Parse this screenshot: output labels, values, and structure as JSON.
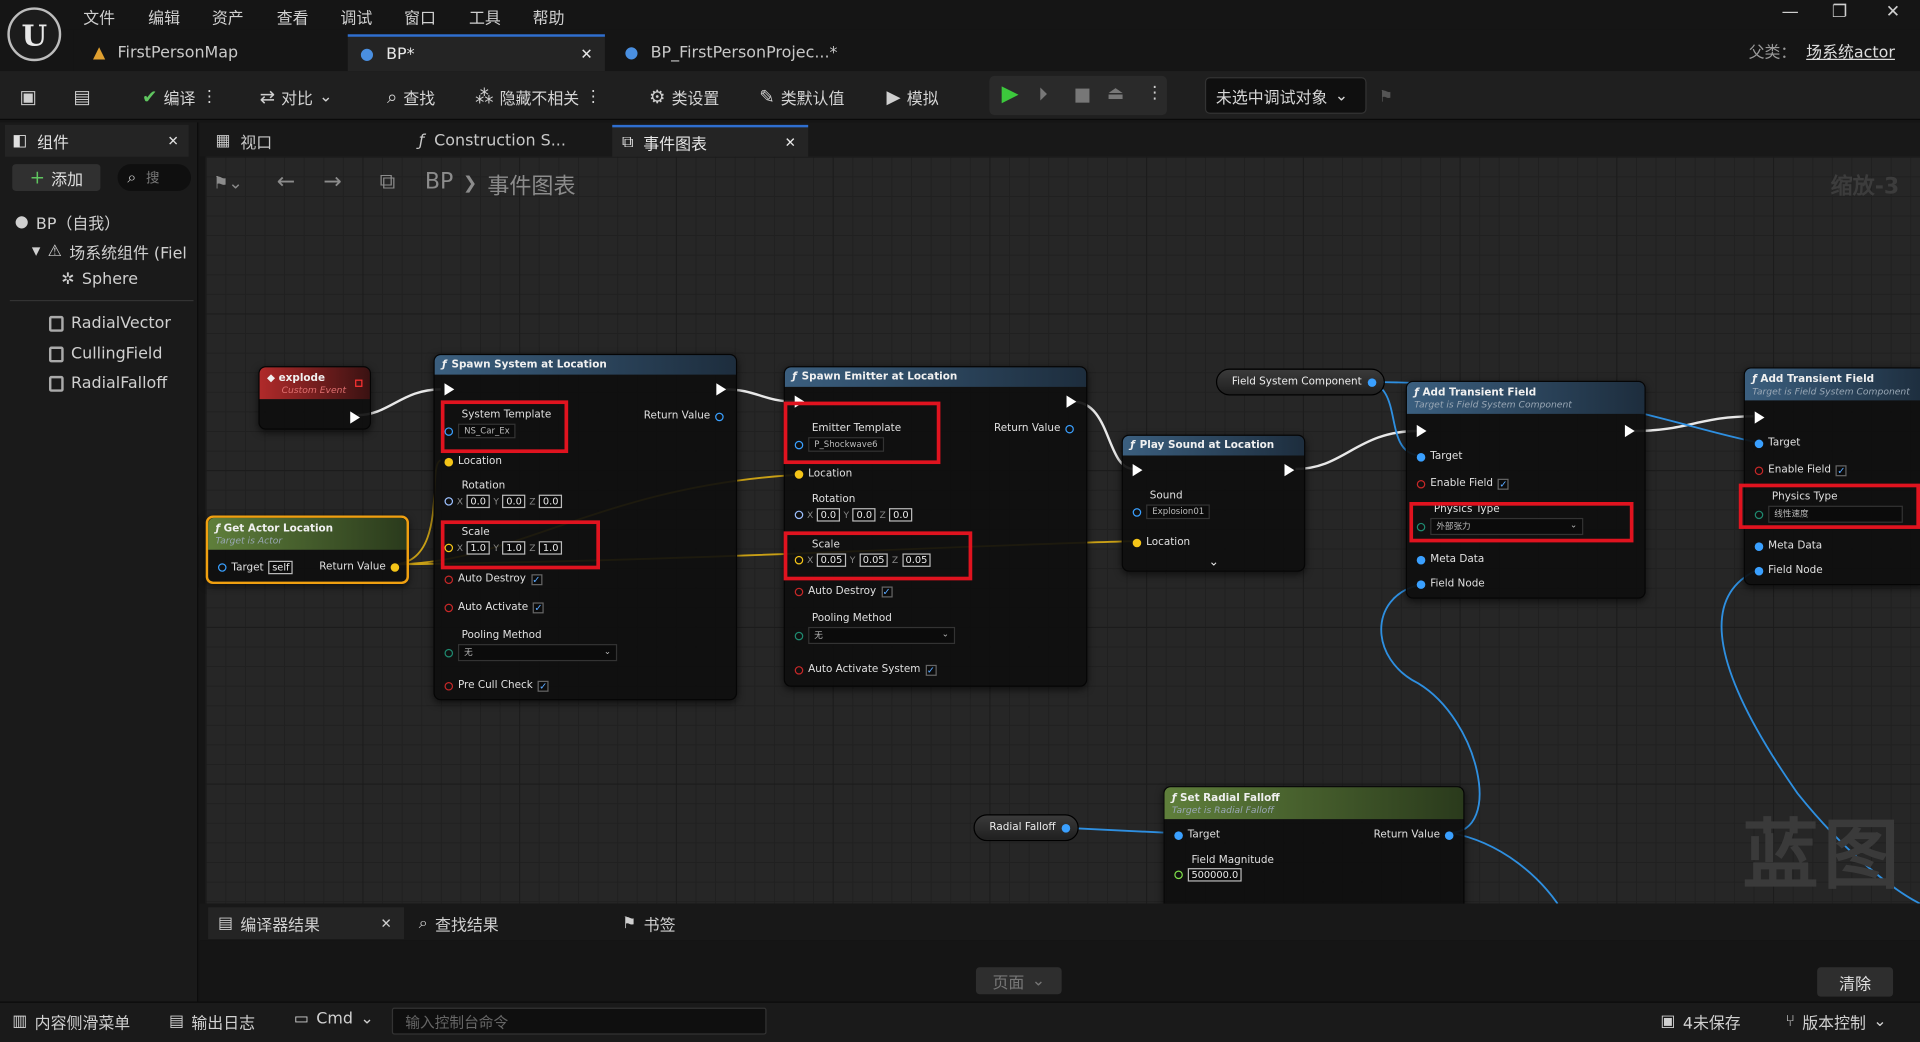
{
  "menu": [
    "文件",
    "编辑",
    "资产",
    "查看",
    "调试",
    "窗口",
    "工具",
    "帮助"
  ],
  "logo": "U",
  "window_controls": [
    "—",
    "❐",
    "✕"
  ],
  "doc_tabs": [
    {
      "label": "FirstPersonMap"
    },
    {
      "label": "BP*"
    },
    {
      "label": "BP_FirstPersonProjec...*"
    }
  ],
  "parent_class": {
    "prefix": "父类：",
    "name": "场系统actor"
  },
  "toolbar": {
    "compile": "编译",
    "diff": "对比",
    "find": "查找",
    "hide_unrelated": "隐藏不相关",
    "class_settings": "类设置",
    "class_defaults": "类默认值",
    "simulate": "模拟",
    "debug_object": "未选中调试对象"
  },
  "components_panel": {
    "tab": "组件",
    "add_button": "添加",
    "search_placeholder": "搜",
    "tree": [
      "BP（自我）",
      "场系统组件 (Fiel",
      "Sphere"
    ],
    "variables": [
      "RadialVector",
      "CullingField",
      "RadialFalloff"
    ]
  },
  "graph_tabs": [
    {
      "label": "视口"
    },
    {
      "label": "Construction S..."
    },
    {
      "label": "事件图表"
    }
  ],
  "breadcrumb": {
    "root": "BP",
    "sep": "❯",
    "current": "事件图表"
  },
  "zoom_label": "缩放-3",
  "watermark": "蓝图",
  "nodes": {
    "explode": {
      "title": "explode",
      "subtitle": "Custom Event"
    },
    "get_actor_location": {
      "title": "Get Actor Location",
      "subtitle": "Target is Actor",
      "target": "Target",
      "target_value": "self",
      "return": "Return Value"
    },
    "spawn_system": {
      "title": "Spawn System at Location",
      "system_template": "System Template",
      "template_value": "NS_Car_Ex",
      "return": "Return Value",
      "location": "Location",
      "rotation": "Rotation",
      "rot": [
        "0.0",
        "0.0",
        "0.0"
      ],
      "scale": "Scale",
      "scl": [
        "1.0",
        "1.0",
        "1.0"
      ],
      "auto_destroy": "Auto Destroy",
      "auto_activate": "Auto Activate",
      "pooling": "Pooling Method",
      "pooling_value": "无",
      "pre_cull": "Pre Cull Check"
    },
    "spawn_emitter": {
      "title": "Spawn Emitter at Location",
      "emitter_template": "Emitter Template",
      "template_value": "P_Shockwave6",
      "return": "Return Value",
      "location": "Location",
      "rotation": "Rotation",
      "rot": [
        "0.0",
        "0.0",
        "0.0"
      ],
      "scale": "Scale",
      "scl": [
        "0.05",
        "0.05",
        "0.05"
      ],
      "auto_destroy": "Auto Destroy",
      "pooling": "Pooling Method",
      "pooling_value": "无",
      "auto_activate_system": "Auto Activate System"
    },
    "play_sound": {
      "title": "Play Sound at Location",
      "sound": "Sound",
      "sound_value": "Explosion01",
      "location": "Location"
    },
    "field_system_component": "Field System Component",
    "add_transient_1": {
      "title": "Add Transient Field",
      "subtitle": "Target is Field System Component",
      "target": "Target",
      "enable": "Enable Field",
      "physics": "Physics Type",
      "physics_value": "外部张力",
      "meta": "Meta Data",
      "field_node": "Field Node"
    },
    "add_transient_2": {
      "title": "Add Transient Field",
      "subtitle": "Target is Field System Component",
      "target": "Target",
      "enable": "Enable Field",
      "physics": "Physics Type",
      "physics_value": "线性速度",
      "meta": "Meta Data",
      "field_node": "Field Node"
    },
    "radial_falloff_var": "Radial Falloff",
    "set_radial_falloff": {
      "title": "Set Radial Falloff",
      "subtitle": "Target is Radial Falloff",
      "target": "Target",
      "return": "Return Value",
      "magnitude": "Field Magnitude",
      "magnitude_value": "500000.0"
    }
  },
  "axis_labels": [
    "X",
    "Y",
    "Z"
  ],
  "bottom_tabs": [
    {
      "label": "编译器结果"
    },
    {
      "label": "查找结果"
    },
    {
      "label": "书签"
    }
  ],
  "page_button": "页面",
  "clear_button": "清除",
  "statusbar": {
    "content_drawer": "内容侧滑菜单",
    "output_log": "输出日志",
    "cmd": "Cmd",
    "console_placeholder": "输入控制台命令",
    "unsaved": "4未保存",
    "source_control": "版本控制"
  },
  "colors": {
    "accent": "#2f6fd0",
    "highlight": "#e0131f",
    "exec": "#ffffff",
    "vector": "#f5c518",
    "object": "#3aa0ff",
    "bool": "#c62828",
    "struct": "#4da6ff"
  }
}
